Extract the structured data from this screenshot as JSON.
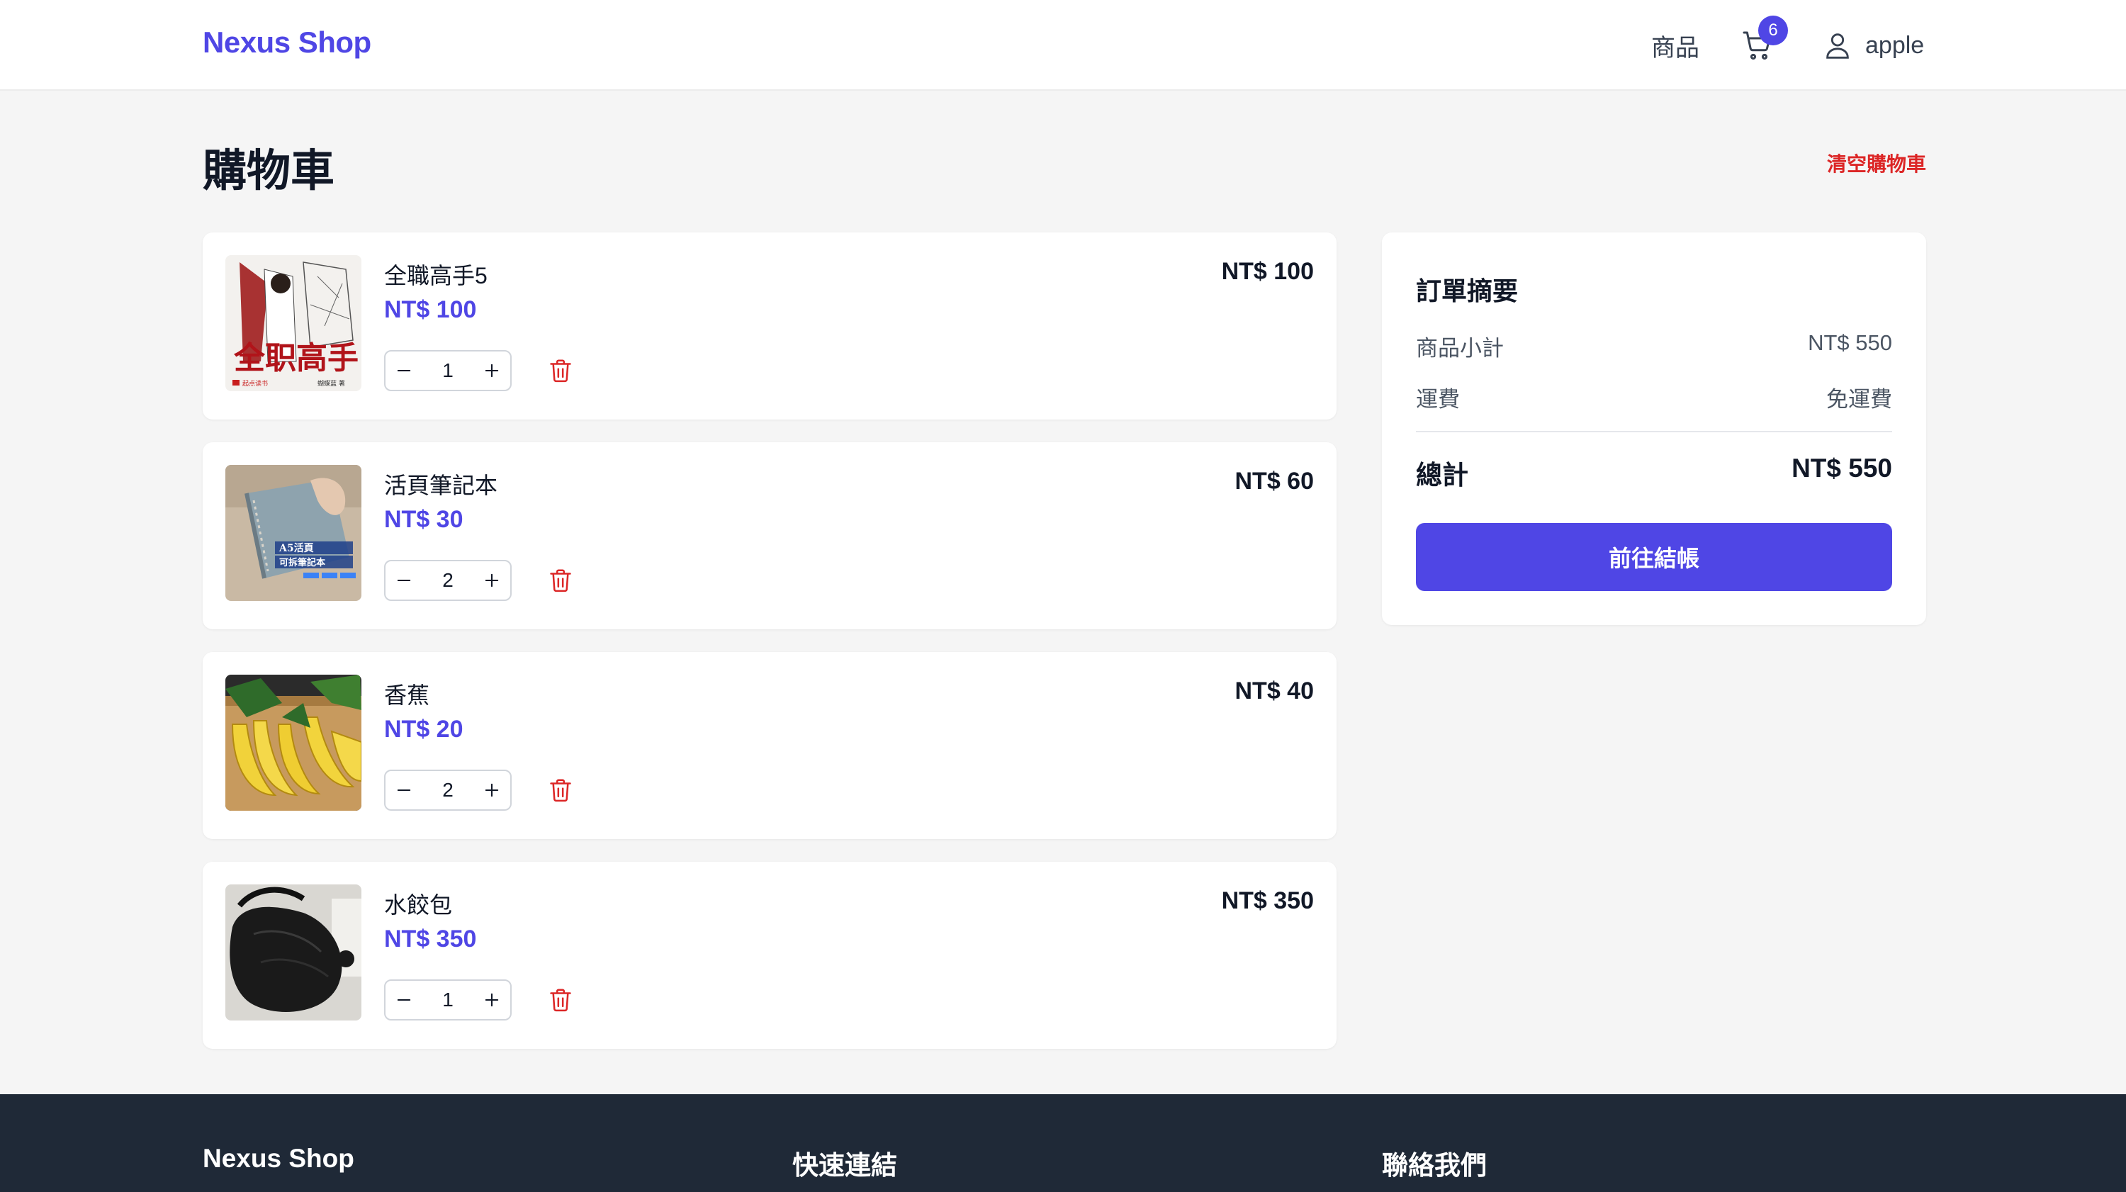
{
  "header": {
    "brand": "Nexus Shop",
    "nav_products": "商品",
    "cart_count": "6",
    "username": "apple"
  },
  "page": {
    "title": "購物車",
    "clear_cart": "清空購物車"
  },
  "cart": {
    "items": [
      {
        "name": "全職高手5",
        "unit_price": "NT$ 100",
        "quantity": "1",
        "line_total": "NT$ 100",
        "image": "book-cover"
      },
      {
        "name": "活頁筆記本",
        "unit_price": "NT$ 30",
        "quantity": "2",
        "line_total": "NT$ 60",
        "image": "notebook-photo"
      },
      {
        "name": "香蕉",
        "unit_price": "NT$ 20",
        "quantity": "2",
        "line_total": "NT$ 40",
        "image": "banana-photo"
      },
      {
        "name": "水餃包",
        "unit_price": "NT$ 350",
        "quantity": "1",
        "line_total": "NT$ 350",
        "image": "bag-photo"
      }
    ]
  },
  "summary": {
    "title": "訂單摘要",
    "subtotal_label": "商品小計",
    "subtotal_value": "NT$ 550",
    "shipping_label": "運費",
    "shipping_value": "免運費",
    "total_label": "總計",
    "total_value": "NT$ 550",
    "checkout_label": "前往結帳"
  },
  "footer": {
    "brand": "Nexus Shop",
    "quick_links": "快速連結",
    "contact": "聯絡我們"
  },
  "colors": {
    "accent": "#4f46e5",
    "danger": "#dc2626",
    "footer_bg": "#1f2937"
  }
}
